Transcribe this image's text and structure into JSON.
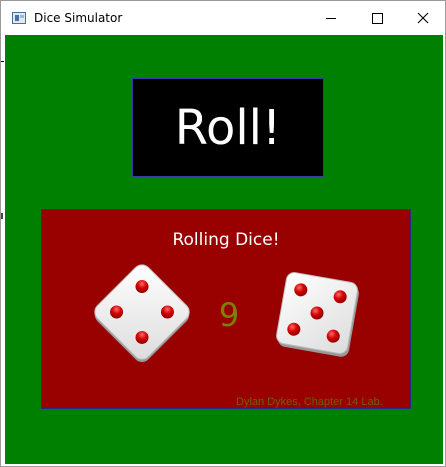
{
  "window": {
    "title": "Dice Simulator",
    "icon": "app-window-icon"
  },
  "controls": {
    "minimize_icon": "minimize-icon",
    "maximize_icon": "maximize-icon",
    "close_icon": "close-icon"
  },
  "main": {
    "roll_button_label": "Roll!",
    "status_text": "Rolling Dice!",
    "total": "9",
    "credit": "Dylan Dykes, Chapter 14 Lab."
  },
  "dice": [
    {
      "name": "die-left",
      "value": 4
    },
    {
      "name": "die-right",
      "value": 5
    }
  ],
  "colors": {
    "background": "#008000",
    "panel": "#990000",
    "button": "#000000",
    "pip": "#cc0000",
    "total_text": "#808000"
  }
}
